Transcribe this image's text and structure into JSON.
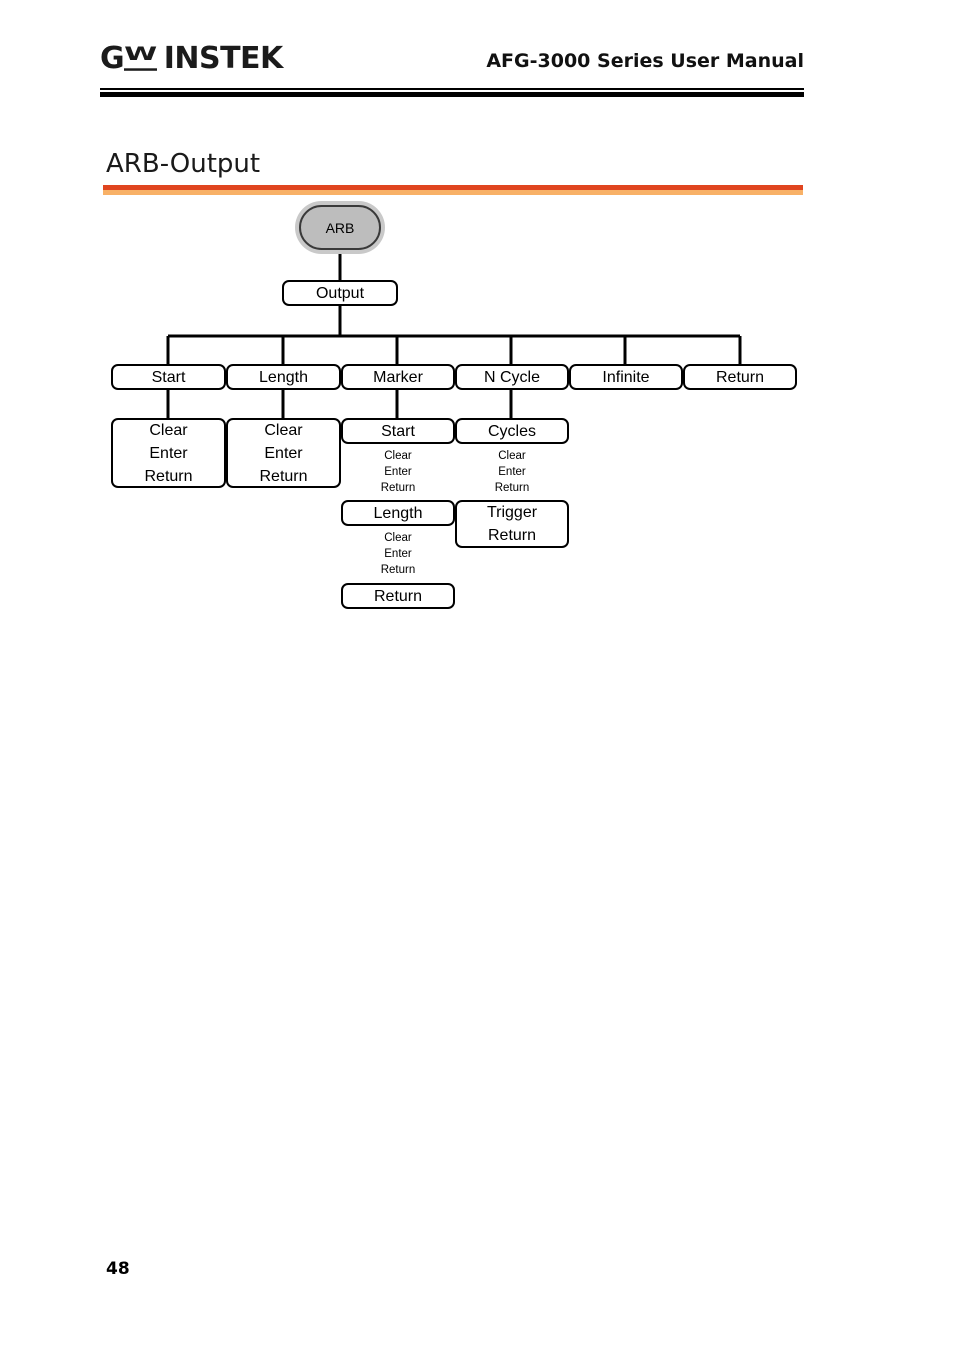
{
  "header": {
    "logo_g": "G",
    "logo_w": "W",
    "logo_instek": "INSTEK",
    "logo_alt": "GW INSTEK",
    "manual_title": "AFG-3000 Series User Manual"
  },
  "section": {
    "heading": "ARB-Output"
  },
  "footer": {
    "page_number": "48"
  },
  "colors": {
    "rule_orange_top": "#e0451f",
    "rule_orange_bottom": "#f8b167",
    "node_border": "#000000",
    "node_fill": "#ffffff",
    "root_fill": "#bdbdbd",
    "root_shadow": "#c9c9c9",
    "connector": "#000000"
  },
  "diagram": {
    "type": "tree",
    "root": {
      "label": "ARB"
    },
    "level1": {
      "label": "Output"
    },
    "level2": [
      {
        "label": "Start"
      },
      {
        "label": "Length"
      },
      {
        "label": "Marker"
      },
      {
        "label": "N Cycle"
      },
      {
        "label": "Infinite"
      },
      {
        "label": "Return"
      }
    ],
    "start_options": {
      "line1": "Clear",
      "line2": "Enter",
      "line3": "Return"
    },
    "length_options": {
      "line1": "Clear",
      "line2": "Enter",
      "line3": "Return"
    },
    "marker_children": [
      {
        "label": "Start",
        "sub1": "Clear",
        "sub2": "Enter",
        "sub3": "Return"
      },
      {
        "label": "Length",
        "sub1": "Clear",
        "sub2": "Enter",
        "sub3": "Return"
      },
      {
        "label": "Return"
      }
    ],
    "ncycle_children": [
      {
        "label": "Cycles",
        "sub1": "Clear",
        "sub2": "Enter",
        "sub3": "Return"
      },
      {
        "label_line1": "Trigger",
        "label_line2": "Return"
      }
    ]
  }
}
